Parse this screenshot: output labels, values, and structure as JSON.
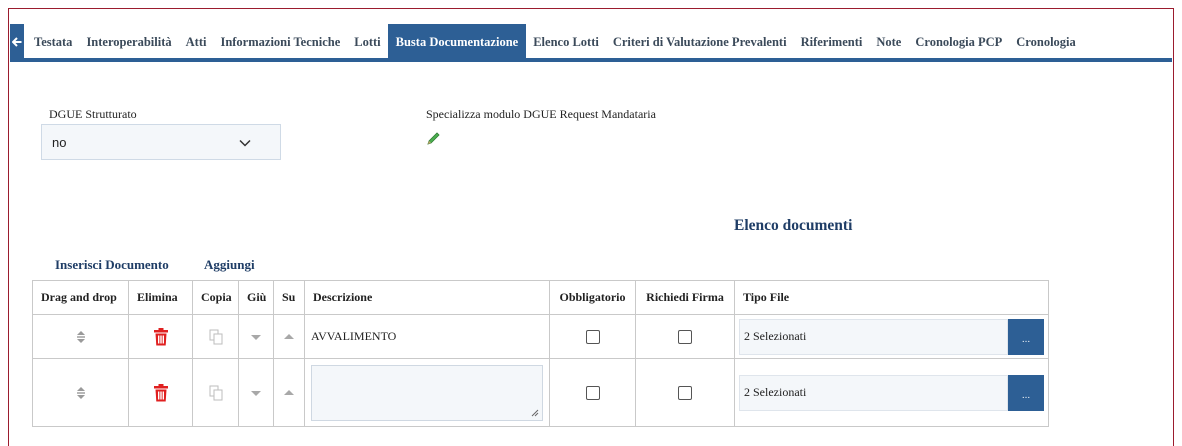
{
  "colors": {
    "primary": "#2d5f95",
    "danger": "#e02020",
    "frame": "#9b1c2e",
    "heading": "#1f3d66"
  },
  "tabs": [
    {
      "label": "Testata",
      "active": false
    },
    {
      "label": "Interoperabilità",
      "active": false
    },
    {
      "label": "Atti",
      "active": false
    },
    {
      "label": "Informazioni Tecniche",
      "active": false
    },
    {
      "label": "Lotti",
      "active": false
    },
    {
      "label": "Busta Documentazione",
      "active": true
    },
    {
      "label": "Elenco Lotti",
      "active": false
    },
    {
      "label": "Criteri di Valutazione Prevalenti",
      "active": false
    },
    {
      "label": "Riferimenti",
      "active": false
    },
    {
      "label": "Note",
      "active": false
    },
    {
      "label": "Cronologia PCP",
      "active": false
    },
    {
      "label": "Cronologia",
      "active": false
    }
  ],
  "form": {
    "dgue_label": "DGUE Strutturato",
    "dgue_value": "no",
    "specializza_label": "Specializza modulo DGUE Request Mandataria"
  },
  "section_title": "Elenco documenti",
  "actions": {
    "insert": "Inserisci Documento",
    "add": "Aggiungi"
  },
  "table": {
    "headers": {
      "drag": "Drag and drop",
      "elimina": "Elimina",
      "copia": "Copia",
      "giu": "Giù",
      "su": "Su",
      "descrizione": "Descrizione",
      "obbligatorio": "Obbligatorio",
      "firma": "Richiedi Firma",
      "tipo": "Tipo File"
    },
    "rows": [
      {
        "descrizione": "AVVALIMENTO",
        "obbligatorio": false,
        "firma": false,
        "tipo_file": "2 Selezionati",
        "tipo_btn": "..."
      },
      {
        "descrizione": "",
        "obbligatorio": false,
        "firma": false,
        "tipo_file": "2 Selezionati",
        "tipo_btn": "..."
      }
    ]
  }
}
